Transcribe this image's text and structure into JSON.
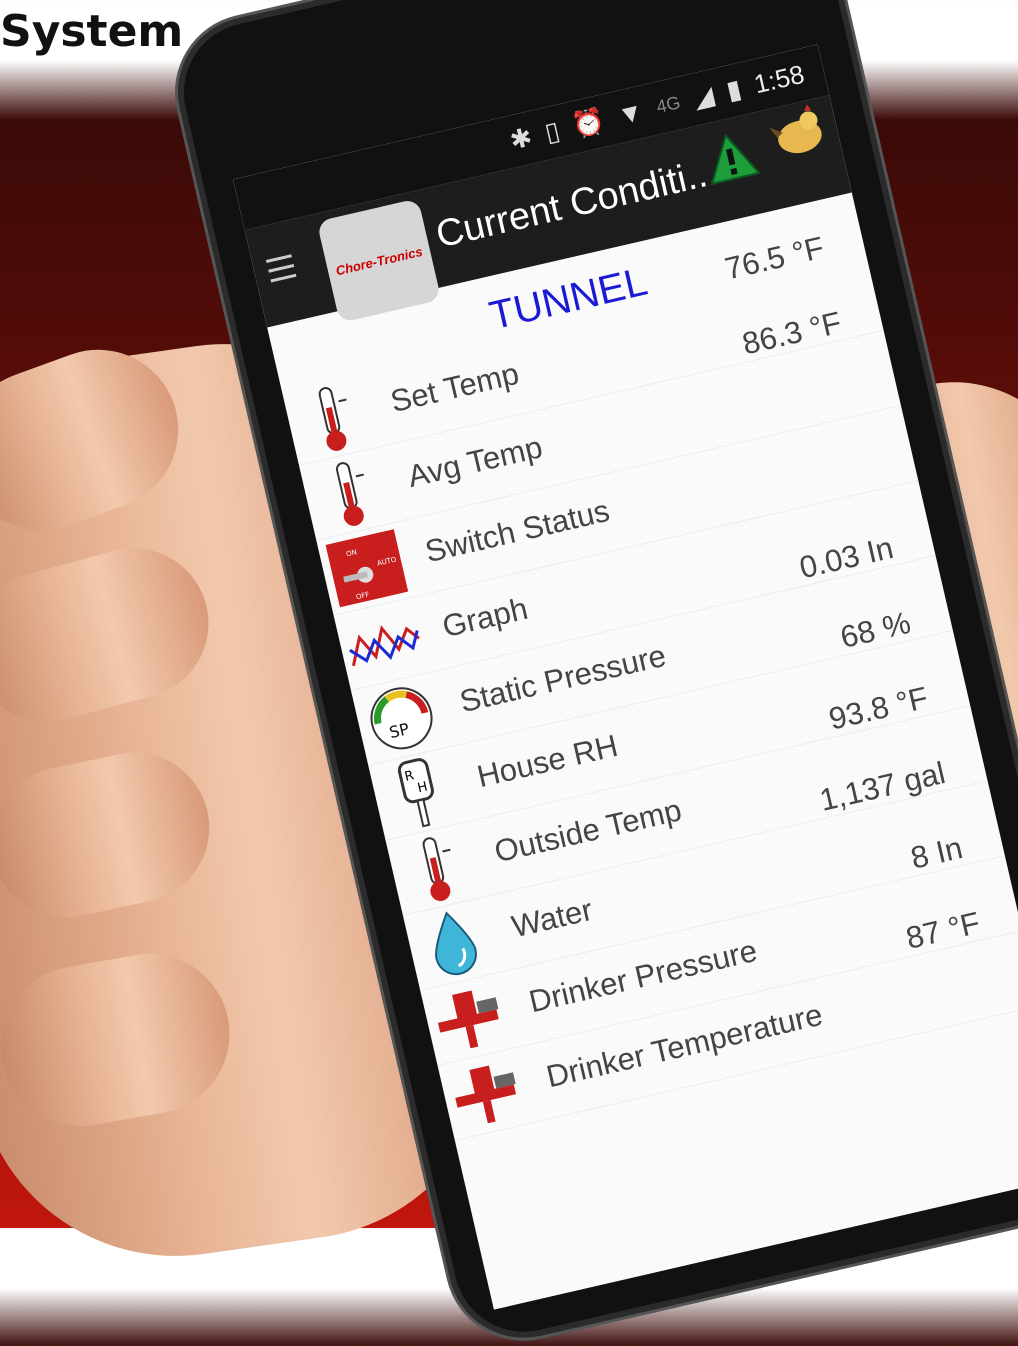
{
  "page_heading": "System",
  "status_bar": {
    "time": "1:58",
    "network": "4G"
  },
  "app_bar": {
    "title": "Current Conditi...",
    "logo_text": "Chore-Tronics"
  },
  "mode_label": "TUNNEL",
  "rows": [
    {
      "label": "Set Temp",
      "value": "76.5 °F",
      "icon": "thermometer-icon"
    },
    {
      "label": "Avg Temp",
      "value": "86.3 °F",
      "icon": "thermometer-icon"
    },
    {
      "label": "Switch Status",
      "value": "",
      "icon": "switch-icon"
    },
    {
      "label": "Graph",
      "value": "",
      "icon": "graph-icon"
    },
    {
      "label": "Static Pressure",
      "value": "0.03 In",
      "icon": "gauge-icon"
    },
    {
      "label": "House RH",
      "value": "68 %",
      "icon": "humidity-icon"
    },
    {
      "label": "Outside Temp",
      "value": "93.8 °F",
      "icon": "thermometer-icon"
    },
    {
      "label": "Water",
      "value": "1,137 gal",
      "icon": "water-drop-icon"
    },
    {
      "label": "Drinker Pressure",
      "value": "8 In",
      "icon": "drinker-regulator-icon"
    },
    {
      "label": "Drinker Temperature",
      "value": "87 °F",
      "icon": "drinker-regulator-icon"
    }
  ],
  "colors": {
    "accent": "#1a1ad6",
    "alert": "#1e9e3a",
    "app_bar": "#1d1d1d"
  }
}
